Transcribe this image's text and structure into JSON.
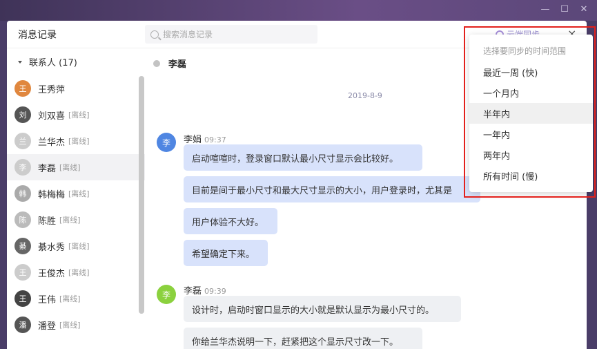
{
  "window": {
    "title": "消息记录",
    "search_placeholder": "搜索消息记录",
    "sync_label": "云端同步",
    "close": "×"
  },
  "win_controls": {
    "minimize": "—",
    "maximize": "☐",
    "close": "✕"
  },
  "sidebar": {
    "group_label": "联系人 (17)",
    "contacts": [
      {
        "initial": "王",
        "name": "王秀萍",
        "status": "",
        "color": "#e0873f"
      },
      {
        "initial": "刘",
        "name": "刘双喜",
        "status": "[离线]",
        "color": "#555555"
      },
      {
        "initial": "兰",
        "name": "兰华杰",
        "status": "[离线]",
        "color": "#cccccc"
      },
      {
        "initial": "李",
        "name": "李磊",
        "status": "[离线]",
        "color": "#cccccc"
      },
      {
        "initial": "韩",
        "name": "韩梅梅",
        "status": "[离线]",
        "color": "#aaaaaa"
      },
      {
        "initial": "陈",
        "name": "陈胜",
        "status": "[离线]",
        "color": "#bbbbbb"
      },
      {
        "initial": "綦",
        "name": "綦水秀",
        "status": "[离线]",
        "color": "#666666"
      },
      {
        "initial": "王",
        "name": "王俊杰",
        "status": "[离线]",
        "color": "#cccccc"
      },
      {
        "initial": "王",
        "name": "王伟",
        "status": "[离线]",
        "color": "#444444"
      },
      {
        "initial": "潘",
        "name": "潘登",
        "status": "[离线]",
        "color": "#555555"
      }
    ]
  },
  "chat": {
    "contact_name": "李磊",
    "date": "2019-8-9",
    "messages": [
      {
        "initial": "李",
        "sender": "李娟",
        "time": "09:37",
        "avatar_color": "#4f86e2",
        "bubbles": [
          "启动喧喧时，登录窗口默认最小尺寸显示会比较好。",
          "目前是间于最小尺寸和最大尺寸显示的大小，用户登录时，尤其是",
          "用户体验不大好。",
          "希望确定下来。"
        ]
      },
      {
        "initial": "李",
        "sender": "李磊",
        "time": "09:39",
        "avatar_color": "#8bd13e",
        "bubbles": [
          "设计时，启动时窗口显示的大小就是默认显示为最小尺寸的。",
          "你给兰华杰说明一下，赶紧把这个显示尺寸改一下。"
        ]
      }
    ]
  },
  "sync_dropdown": {
    "header": "选择要同步的时间范围",
    "options": [
      "最近一周 (快)",
      "一个月内",
      "半年内",
      "一年内",
      "两年内",
      "所有时间 (慢)"
    ],
    "hovered": "半年内"
  }
}
